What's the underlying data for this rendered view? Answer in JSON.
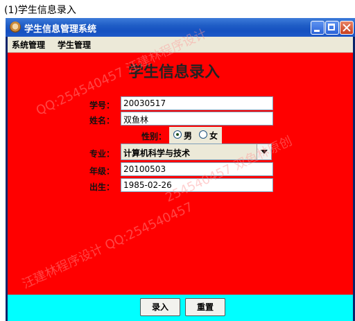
{
  "caption": "(1)学生信息录入",
  "window": {
    "title": "学生信息管理系统"
  },
  "menu": [
    "系统管理",
    "学生管理"
  ],
  "form": {
    "title": "学生信息录入",
    "student_id_label": "学号：",
    "student_id": "20030517",
    "name_label": "姓名：",
    "name": "双鱼林",
    "gender_label": "性别：",
    "gender_options": [
      "男",
      "女"
    ],
    "gender_selected": "男",
    "major_label": "专业：",
    "major": "计算机科学与技术",
    "grade_label": "年级：",
    "grade": "20100503",
    "birth_label": "出生：",
    "birth": "1985-02-26"
  },
  "buttons": {
    "submit": "录入",
    "reset": "重置"
  },
  "watermark": [
    "QQ:254540457 汪建林程序设计",
    "254540457 双鱼林原创",
    "汪建林程序设计 QQ:254540457"
  ],
  "colors": {
    "content_bg": "#ff0000",
    "footer_bg": "#00ffff",
    "titlebar": "#1f5dc6"
  }
}
